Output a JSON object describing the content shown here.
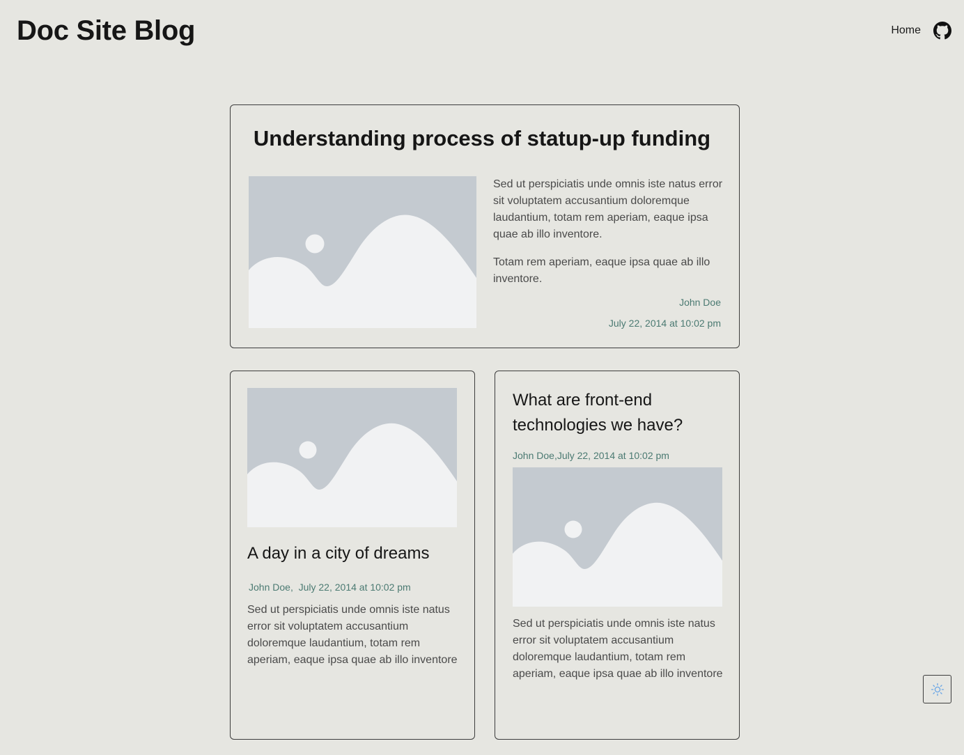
{
  "site": {
    "title": "Doc Site Blog"
  },
  "nav": {
    "home_label": "Home",
    "github_icon": "github-icon"
  },
  "featured_post": {
    "title": "Understanding process of statup-up funding",
    "paragraph_1": "Sed ut perspiciatis unde omnis iste natus error sit voluptatem accusantium doloremque laudantium, totam rem aperiam, eaque ipsa quae ab illo inventore.",
    "paragraph_2": "Totam rem aperiam, eaque ipsa quae ab illo inventore.",
    "author": "John Doe",
    "date": "July 22, 2014 at 10:02 pm",
    "image_icon": "image-placeholder-icon"
  },
  "posts": [
    {
      "title": "A day in a city of dreams",
      "author": "John Doe",
      "separator": ",",
      "date": "July 22, 2014 at 10:02 pm",
      "excerpt": "Sed ut perspiciatis unde omnis iste natus error sit voluptatem accusantium doloremque laudantium, totam rem aperiam, eaque ipsa quae ab illo inventore"
    },
    {
      "title": "What are front-end technologies we have?",
      "author": "John Doe",
      "separator": ",",
      "date": "July 22, 2014 at 10:02 pm",
      "excerpt": "Sed ut perspiciatis unde omnis iste natus error sit voluptatem accusantium doloremque laudantium, totam rem aperiam, eaque ipsa quae ab illo inventore"
    }
  ],
  "theme_toggle": {
    "icon": "sun-icon"
  },
  "colors": {
    "background": "#e6e6e1",
    "meta_text": "#4b7a72",
    "image_sky": "#c4cad0",
    "image_hill": "#f1f2f3",
    "toggle_icon": "#6aa6e6"
  }
}
